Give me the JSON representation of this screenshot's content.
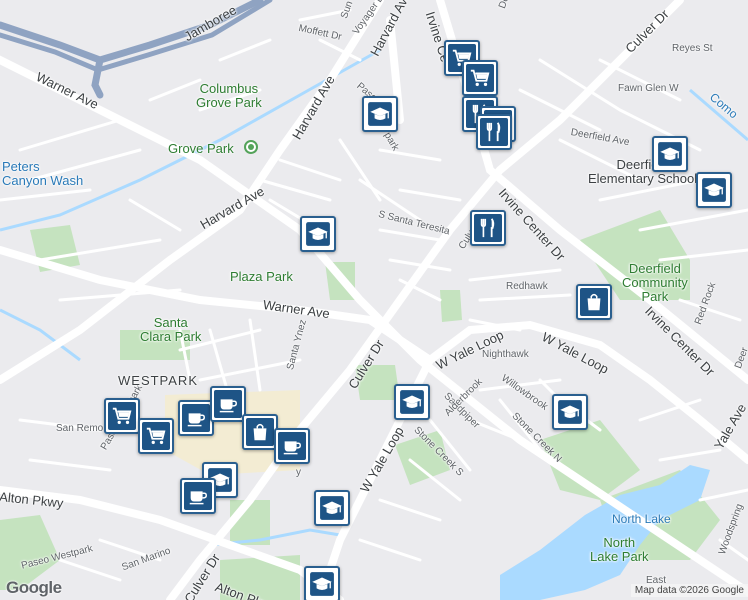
{
  "map": {
    "credit": "Map data ©2026 Google",
    "logo": "Google",
    "colors": {
      "background": "#ebebee",
      "road": "#ffffff",
      "park": "#c5e3bf",
      "water": "#aadaff",
      "highway": "#8fa3c2",
      "poi_pin": "#1e5486",
      "poi_border": "#2a5f8f"
    },
    "streets": {
      "warner_nw": "Warner Ave",
      "warner": "Warner Ave",
      "harvard_mid": "Harvard Ave",
      "harvard_lower": "Harvard Ave",
      "harvard_top": "Harvard Ave",
      "jamboree": "Jamboree",
      "moffett": "Moffett Dr",
      "voyager": "Voyager Dr",
      "sun": "Sun",
      "irvine_center_top": "Irvine Ce",
      "irvine_center_mid": "Irvine Center Dr",
      "irvine_center_right": "Irvine Center Dr",
      "culver_top": "Culver Dr",
      "culver_mid": "Culver Dr",
      "culver_lower": "Culver Dr",
      "culver_bottom": "Culver Dr",
      "deerfield_top": "Deerfield Ave",
      "deerfield_ave": "Deerfield Ave",
      "reyes": "Reyes St",
      "fawn_glen": "Fawn Glen W",
      "santa_teresita": "S Santa Teresita",
      "paseo_top": "Paseo",
      "park": "park",
      "redhawk": "Redhawk",
      "red_rock": "Red Rock",
      "w_yale_loop": "W Yale Loop",
      "w_yale_loop_right": "W Yale Loop",
      "w_yale_loop_lower": "W Yale Loop",
      "yale_ave": "Yale Ave",
      "nighthawk": "Nighthawk",
      "sandpiper": "Sandpiper",
      "willowbrook": "Willowbrook",
      "alderbrook": "Alderbrook",
      "stone_creek_s": "Stone Creek S",
      "stone_creek_n": "Stone Creek N",
      "santa_ynez": "Santa Ynez",
      "san_remo": "San Remo",
      "paseo_westpark_top": "Paseo Westpark",
      "paseo_westpark": "Paseo Westpark",
      "alton": "Alton Pkwy",
      "alton_lower": "Alton Pkwy",
      "san_marino": "San Marino",
      "como": "Como",
      "woodspring": "Woodspring",
      "east": "East",
      "deer": "Deer",
      "truncated_y": "y"
    },
    "places": {
      "columbus_grove_park": "Columbus\nGrove Park",
      "grove_park": "Grove Park",
      "peters_canyon_wash": "Peters\nCanyon Wash",
      "plaza_park": "Plaza Park",
      "santa_clara_park": "Santa\nClara Park",
      "westpark": "WESTPARK",
      "deerfield_elementary": "Deerfield\nElementary School",
      "deerfield_community_park": "Deerfield\nCommunity\nPark",
      "north_lake": "North Lake",
      "north_lake_park": "North\nLake Park"
    },
    "pois": [
      {
        "type": "school",
        "icon": "graduation-cap-icon"
      },
      {
        "type": "shopping",
        "icon": "shopping-cart-icon"
      },
      {
        "type": "shopping",
        "icon": "shopping-cart-icon"
      },
      {
        "type": "restaurant",
        "icon": "fork-knife-icon"
      },
      {
        "type": "restaurant",
        "icon": "fork-knife-icon"
      },
      {
        "type": "restaurant",
        "icon": "fork-knife-icon"
      },
      {
        "type": "school",
        "icon": "graduation-cap-icon"
      },
      {
        "type": "school",
        "icon": "graduation-cap-icon"
      },
      {
        "type": "school",
        "icon": "graduation-cap-icon"
      },
      {
        "type": "restaurant",
        "icon": "fork-knife-icon"
      },
      {
        "type": "shopping",
        "icon": "shopping-bag-icon"
      },
      {
        "type": "school",
        "icon": "graduation-cap-icon"
      },
      {
        "type": "school",
        "icon": "graduation-cap-icon"
      },
      {
        "type": "shopping",
        "icon": "shopping-cart-icon"
      },
      {
        "type": "shopping",
        "icon": "shopping-cart-icon"
      },
      {
        "type": "cafe",
        "icon": "coffee-cup-icon"
      },
      {
        "type": "cafe",
        "icon": "coffee-cup-icon"
      },
      {
        "type": "shopping",
        "icon": "shopping-bag-icon"
      },
      {
        "type": "cafe",
        "icon": "coffee-cup-icon"
      },
      {
        "type": "school",
        "icon": "graduation-cap-icon"
      },
      {
        "type": "cafe",
        "icon": "coffee-cup-icon"
      },
      {
        "type": "school",
        "icon": "graduation-cap-icon"
      },
      {
        "type": "school",
        "icon": "graduation-cap-icon"
      }
    ]
  }
}
